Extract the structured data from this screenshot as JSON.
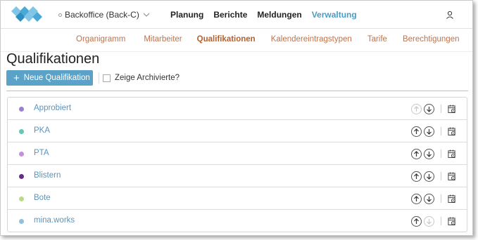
{
  "header": {
    "environment": "Backoffice (Back-C)",
    "nav": [
      {
        "label": "Planung",
        "active": false
      },
      {
        "label": "Berichte",
        "active": false
      },
      {
        "label": "Meldungen",
        "active": false
      },
      {
        "label": "Verwaltung",
        "active": true
      }
    ]
  },
  "subnav": [
    {
      "label": "Organigramm",
      "active": false
    },
    {
      "label": "Mitarbeiter",
      "active": false
    },
    {
      "label": "Qualifikationen",
      "active": true
    },
    {
      "label": "Kalendereintragstypen",
      "active": false
    },
    {
      "label": "Tarife",
      "active": false
    },
    {
      "label": "Berechtigungen",
      "active": false
    }
  ],
  "page": {
    "title": "Qualifikationen",
    "new_button": "Neue Qualifikation",
    "archive_label": "Zeige Archivierte?",
    "archive_checked": false
  },
  "qualifications": [
    {
      "name": "Approbiert",
      "color": "#9b7fd4",
      "up_enabled": false,
      "down_enabled": true
    },
    {
      "name": "PKA",
      "color": "#5fc9b6",
      "up_enabled": true,
      "down_enabled": true
    },
    {
      "name": "PTA",
      "color": "#c78ee0",
      "up_enabled": true,
      "down_enabled": true
    },
    {
      "name": "Blistern",
      "color": "#6a2a86",
      "up_enabled": true,
      "down_enabled": true
    },
    {
      "name": "Bote",
      "color": "#b8dc86",
      "up_enabled": true,
      "down_enabled": true
    },
    {
      "name": "mina.works",
      "color": "#8ec0e0",
      "up_enabled": true,
      "down_enabled": false
    }
  ],
  "icons": {
    "logo": "diamond-logo-icon",
    "user": "user-icon",
    "up": "arrow-up-icon",
    "down": "arrow-down-icon",
    "calendar": "calendar-settings-icon"
  }
}
